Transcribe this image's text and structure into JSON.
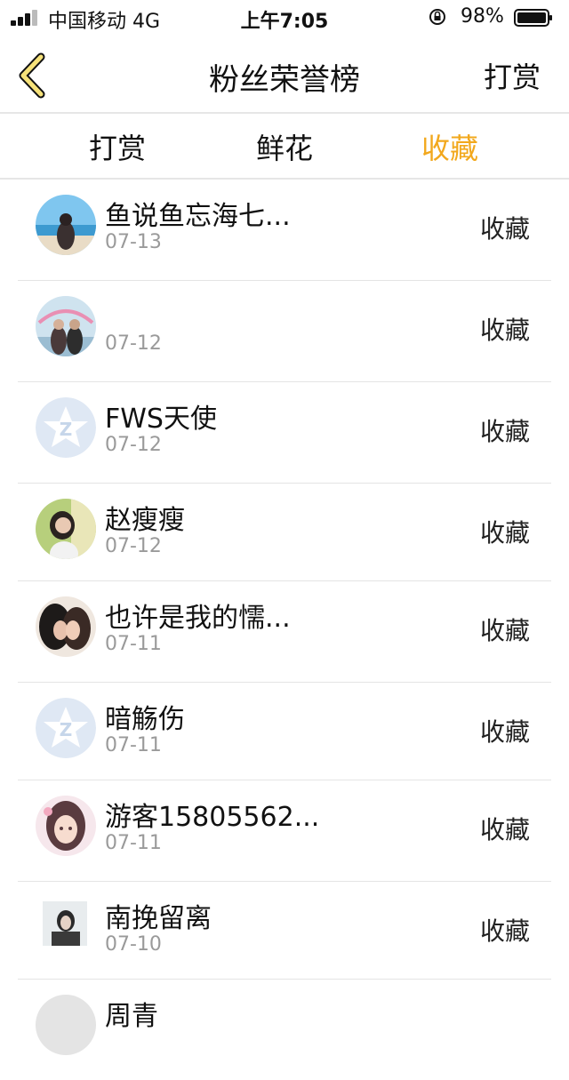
{
  "status_bar": {
    "carrier": "中国移动  4G",
    "time": "上午7:05",
    "battery": "98%"
  },
  "nav": {
    "title": "粉丝荣誉榜",
    "right_label": "打赏",
    "back_icon": "chevron-left-icon",
    "accent_color": "#f2a81d"
  },
  "tabs": [
    {
      "label": "打赏"
    },
    {
      "label": "鲜花"
    },
    {
      "label": "收藏"
    }
  ],
  "list": [
    {
      "name": "鱼说鱼忘海七...",
      "date": "07-13",
      "action": "收藏"
    },
    {
      "name": "",
      "date": "07-12",
      "action": "收藏"
    },
    {
      "name": "FWS天使",
      "date": "07-12",
      "action": "收藏"
    },
    {
      "name": "赵瘦瘦",
      "date": "07-12",
      "action": "收藏"
    },
    {
      "name": "也许是我的懦...",
      "date": "07-11",
      "action": "收藏"
    },
    {
      "name": "暗觞伤",
      "date": "07-11",
      "action": "收藏"
    },
    {
      "name": "游客15805562...",
      "date": "07-11",
      "action": "收藏"
    },
    {
      "name": "南挽留离",
      "date": "07-10",
      "action": "收藏"
    },
    {
      "name": "周青",
      "date": "",
      "action": ""
    }
  ]
}
